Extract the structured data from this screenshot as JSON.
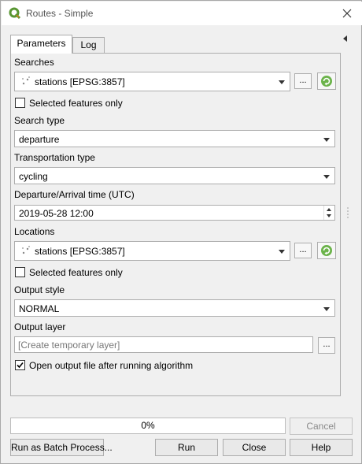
{
  "window": {
    "title": "Routes - Simple",
    "close_glyph": "✕"
  },
  "tabs": [
    {
      "label": "Parameters",
      "active": true
    },
    {
      "label": "Log",
      "active": false
    }
  ],
  "params": {
    "searches_label": "Searches",
    "searches_value": "stations [EPSG:3857]",
    "ellipsis": "...",
    "searches_selected_only": "Selected features only",
    "search_type_label": "Search type",
    "search_type_value": "departure",
    "transport_label": "Transportation type",
    "transport_value": "cycling",
    "time_label": "Departure/Arrival time (UTC)",
    "time_value": "2019-05-28 12:00",
    "locations_label": "Locations",
    "locations_value": "stations [EPSG:3857]",
    "locations_selected_only": "Selected features only",
    "output_style_label": "Output style",
    "output_style_value": "NORMAL",
    "output_layer_label": "Output layer",
    "output_layer_placeholder": "[Create temporary layer]",
    "open_output_label": "Open output file after running algorithm",
    "open_output_checked": true
  },
  "footer": {
    "progress_text": "0%",
    "progress_value": 0,
    "cancel_label": "Cancel",
    "batch_label": "Run as Batch Process...",
    "run_label": "Run",
    "close_label": "Close",
    "help_label": "Help"
  },
  "icons": {
    "app": "qgis-logo-icon",
    "layer": "point-layer-icon",
    "refresh": "iterate-refresh-icon",
    "accent_green": "#4f9a3a"
  }
}
